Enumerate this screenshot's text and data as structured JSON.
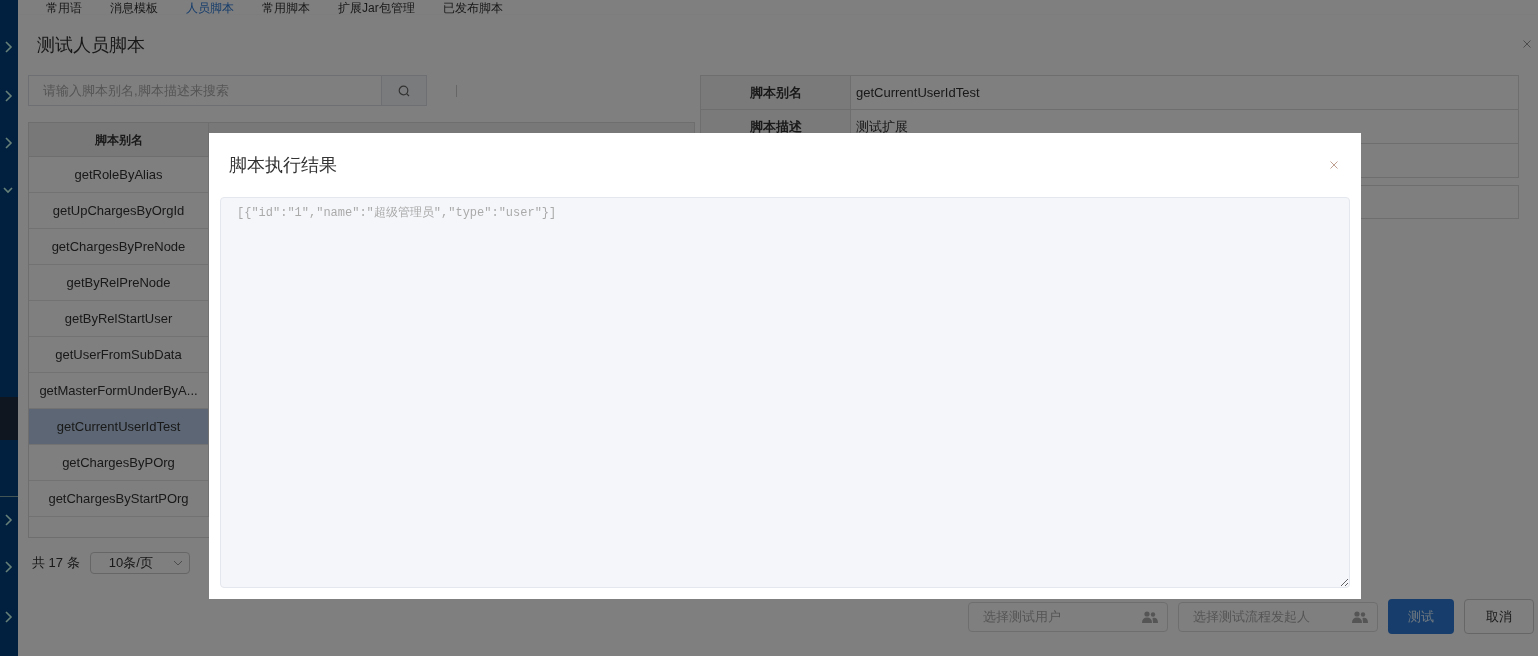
{
  "nav_tabs": [
    {
      "label": "常用语",
      "selected": false
    },
    {
      "label": "消息模板",
      "selected": false
    },
    {
      "label": "人员脚本",
      "selected": true
    },
    {
      "label": "常用脚本",
      "selected": false
    },
    {
      "label": "扩展Jar包管理",
      "selected": false
    },
    {
      "label": "已发布脚本",
      "selected": false
    }
  ],
  "sidebar": {
    "items": [
      {
        "expanded": false
      },
      {
        "expanded": false
      },
      {
        "expanded": false
      },
      {
        "expanded": true
      },
      {
        "expanded": false
      },
      {
        "expanded": false
      },
      {
        "expanded": false
      }
    ]
  },
  "dialog": {
    "title": "测试人员脚本",
    "search": {
      "placeholder": "请输入脚本别名,脚本描述来搜索"
    },
    "table": {
      "columns": [
        "脚本别名"
      ],
      "rows": [
        {
          "alias": "getRoleByAlias",
          "selected": false
        },
        {
          "alias": "getUpChargesByOrgId",
          "selected": false
        },
        {
          "alias": "getChargesByPreNode",
          "selected": false
        },
        {
          "alias": "getByRelPreNode",
          "selected": false
        },
        {
          "alias": "getByRelStartUser",
          "selected": false
        },
        {
          "alias": "getUserFromSubData",
          "selected": false
        },
        {
          "alias": "getMasterFormUnderByA...",
          "selected": false
        },
        {
          "alias": "getCurrentUserIdTest",
          "selected": true
        },
        {
          "alias": "getChargesByPOrg",
          "selected": false
        },
        {
          "alias": "getChargesByStartPOrg",
          "selected": false
        }
      ]
    },
    "pagination": {
      "total": "共 17 条",
      "page_size": "10条/页"
    },
    "details": [
      {
        "label": "脚本别名",
        "value": "getCurrentUserIdTest"
      },
      {
        "label": "脚本描述",
        "value": "测试扩展"
      }
    ],
    "user_field": {
      "placeholder": "选择测试用户"
    },
    "starter_field": {
      "placeholder": "选择测试流程发起人"
    },
    "buttons": [
      {
        "label": "测试",
        "kind": "primary"
      },
      {
        "label": "取消",
        "kind": "default"
      }
    ]
  },
  "result_modal": {
    "title": "脚本执行结果",
    "output": "[{\"id\":\"1\",\"name\":\"超级管理员\",\"type\":\"user\"}]"
  }
}
